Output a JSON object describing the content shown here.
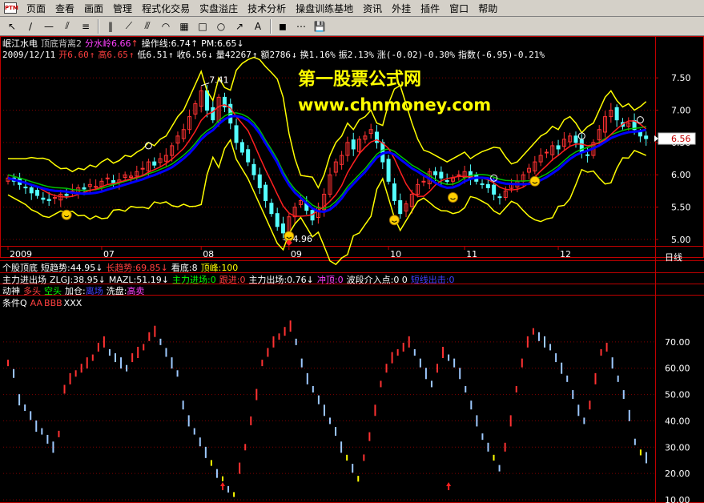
{
  "menu": {
    "items": [
      "页面",
      "查看",
      "画面",
      "管理",
      "程式化交易",
      "实盘溢庄",
      "技术分析",
      "操盘训练基地",
      "资讯",
      "外挂",
      "插件",
      "窗口",
      "帮助"
    ]
  },
  "toolbar": {
    "buttons": [
      {
        "icon": "pointer-icon",
        "glyph": "↖"
      },
      {
        "icon": "line-tool-icon",
        "glyph": "∕"
      },
      {
        "icon": "horizontal-line-icon",
        "glyph": "—"
      },
      {
        "icon": "channel-icon",
        "glyph": "⫽"
      },
      {
        "icon": "fibonacci-icon",
        "glyph": "≡"
      },
      {
        "icon": "vertical-lines-icon",
        "glyph": "‖"
      },
      {
        "icon": "fan-lines-icon",
        "glyph": "⟋"
      },
      {
        "icon": "parallel-lines-icon",
        "glyph": "⫻"
      },
      {
        "icon": "arc-icon",
        "glyph": "◠"
      },
      {
        "icon": "gann-icon",
        "glyph": "▦"
      },
      {
        "icon": "rectangle-icon",
        "glyph": "□"
      },
      {
        "icon": "ellipse-icon",
        "glyph": "○"
      },
      {
        "icon": "arrow-icon",
        "glyph": "↗"
      },
      {
        "icon": "text-icon",
        "glyph": "A"
      },
      {
        "icon": "color-icon",
        "glyph": "◼"
      },
      {
        "icon": "palette-icon",
        "glyph": "⋯"
      },
      {
        "icon": "save-icon",
        "glyph": "💾"
      }
    ]
  },
  "main_header": {
    "stock": "岷江水电",
    "indicator": "顶底背离2",
    "ma_label": "分水岭",
    "ma_value": "6.66",
    "op_label": "操作线",
    "op_value": "6.74",
    "pm_label": "PM",
    "pm_value": "6.65",
    "date": "2009/12/11",
    "open_label": "开",
    "open": "6.60",
    "high_label": "高",
    "high": "6.65",
    "low_label": "低",
    "low": "6.51",
    "close_label": "收",
    "close": "6.56",
    "vol_label": "量",
    "vol": "42267",
    "amt_label": "额",
    "amt": "2786",
    "turn_label": "换",
    "turn": "1.16%",
    "amp_label": "振",
    "amp": "2.13%",
    "chg_label": "涨",
    "chg": "(-0.02)-0.30%",
    "idx_label": "指数",
    "idx": "(-6.95)-0.21%"
  },
  "watermark": {
    "line1": "第一股票公式网",
    "line2": "www.chnmoney.com"
  },
  "price_axis": {
    "ticks": [
      "7.50",
      "7.00",
      "6.50",
      "6.00",
      "5.50",
      "5.00"
    ],
    "current": "6.56",
    "peak_label": "7.41",
    "trough_label": "4.96"
  },
  "time_axis": {
    "labels": [
      "2009",
      "07",
      "08",
      "09",
      "10",
      "11",
      "12"
    ],
    "period": "日线"
  },
  "sub1": {
    "title": "个股顶底",
    "short_label": "短趋势",
    "short_value": "44.95",
    "long_label": "长趋势",
    "long_value": "69.85",
    "bottom_label": "看底",
    "bottom_value": "8",
    "peak_label": "顶峰",
    "peak_value": "100"
  },
  "sub2": {
    "title": "主力进出场",
    "zlgj_label": "ZLGJ",
    "zlgj_value": "38.95",
    "mazl_label": "MAZL",
    "mazl_value": "51.19",
    "in_label": "主力进场",
    "in_value": "0",
    "follow_label": "跟进",
    "follow_value": "0",
    "out_label": "主力出场",
    "out_value": "0.76",
    "top_label": "冲顶",
    "top_value": "0",
    "wave_label": "波段介入点",
    "wave_value": "0 0",
    "quick_label": "短线出击",
    "quick_value": "0"
  },
  "sub3": {
    "title": "动神",
    "bull": "多头",
    "bear": "空头",
    "add": "加仓",
    "add_value": "离场",
    "wash": "洗盘",
    "sell": "高卖"
  },
  "sub4": {
    "title": "条件Q",
    "aa": "AA",
    "bbb": "BBB",
    "xxx": "XXX"
  },
  "lower_axis": {
    "ticks": [
      "70.00",
      "60.00",
      "50.00",
      "40.00",
      "30.00",
      "20.00",
      "10.00"
    ]
  },
  "colors": {
    "up": "#ff3232",
    "down": "#54ffff",
    "ma_blue": "#0000ff",
    "ma_green": "#00c000",
    "band": "#ffff00",
    "grid": "#800000",
    "axis": "#c00000"
  },
  "chart_data": {
    "type": "candlestick",
    "title": "岷江水电",
    "price_ylim": [
      4.9,
      7.8
    ],
    "price_ticks": [
      5.0,
      5.5,
      6.0,
      6.5,
      7.0,
      7.5
    ],
    "x_labels": [
      "2009",
      "07",
      "08",
      "09",
      "10",
      "11",
      "12"
    ],
    "close_series": [
      5.95,
      5.9,
      5.85,
      5.8,
      5.72,
      5.68,
      5.62,
      5.6,
      5.65,
      5.7,
      5.68,
      5.75,
      5.8,
      5.78,
      5.85,
      5.82,
      5.9,
      5.95,
      5.88,
      5.92,
      6.0,
      5.98,
      6.05,
      6.1,
      6.2,
      6.15,
      6.25,
      6.3,
      6.45,
      6.6,
      6.7,
      6.9,
      7.1,
      7.3,
      7.0,
      6.85,
      7.2,
      7.05,
      6.8,
      6.5,
      6.35,
      6.2,
      6.0,
      5.8,
      5.6,
      5.4,
      5.2,
      5.1,
      5.35,
      5.5,
      5.6,
      5.45,
      5.3,
      5.5,
      5.7,
      6.0,
      6.2,
      6.3,
      6.5,
      6.4,
      6.55,
      6.6,
      6.7,
      6.5,
      6.2,
      5.9,
      5.6,
      5.4,
      5.55,
      5.7,
      5.85,
      5.9,
      6.05,
      6.0,
      5.95,
      5.9,
      5.95,
      6.0,
      6.05,
      5.95,
      5.9,
      5.85,
      5.8,
      5.7,
      5.65,
      5.75,
      5.85,
      5.9,
      6.0,
      6.1,
      6.2,
      6.3,
      6.35,
      6.45,
      6.4,
      6.55,
      6.6,
      6.5,
      6.35,
      6.3,
      6.5,
      6.7,
      6.9,
      7.0,
      6.85,
      6.75,
      6.8,
      6.7,
      6.6,
      6.56
    ],
    "sub4_ylim": [
      10,
      80
    ],
    "sub4_ticks": [
      10,
      20,
      30,
      40,
      50,
      60,
      70
    ],
    "sub4_values": [
      62,
      58,
      48,
      45,
      42,
      38,
      36,
      33,
      30,
      35,
      52,
      56,
      58,
      60,
      62,
      64,
      68,
      70,
      66,
      64,
      62,
      60,
      64,
      66,
      68,
      72,
      74,
      70,
      66,
      62,
      58,
      46,
      40,
      36,
      32,
      28,
      24,
      20,
      18,
      14,
      12,
      22,
      30,
      40,
      50,
      62,
      66,
      70,
      72,
      74,
      76,
      70,
      62,
      56,
      52,
      48,
      44,
      40,
      36,
      30,
      26,
      22,
      18,
      26,
      34,
      44,
      54,
      60,
      64,
      66,
      68,
      70,
      66,
      62,
      58,
      54,
      60,
      66,
      64,
      62,
      58,
      52,
      46,
      40,
      34,
      30,
      26,
      22,
      30,
      40,
      52,
      62,
      70,
      74,
      72,
      70,
      68,
      64,
      60,
      56,
      50,
      44,
      40,
      46,
      56,
      66,
      68,
      62,
      56,
      50,
      42,
      32,
      28,
      26
    ]
  }
}
